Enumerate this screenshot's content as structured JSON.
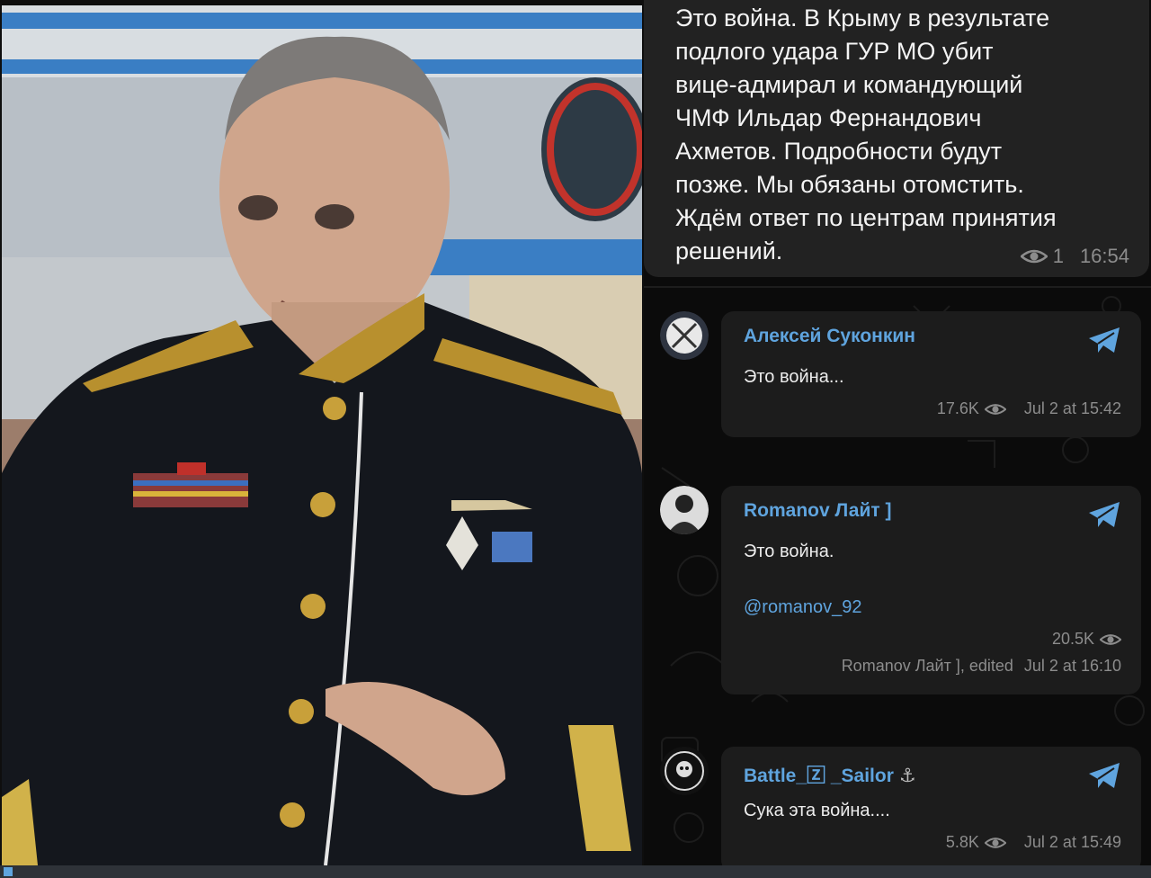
{
  "top_message": {
    "text": "Это война. В Крыму в результате\nподлого удара ГУР МО убит\nвице-адмирал и командующий\nЧМФ Ильдар Фернандович\nАхметов. Подробности будут\nпозже. Мы обязаны отомстить.\nЖдём ответ по центрам принятия\nрешений.",
    "views": "1",
    "time": "16:54"
  },
  "posts": [
    {
      "author": "Алексей Суконкин",
      "text": "Это война...",
      "views": "17.6K",
      "date": "Jul 2 at 15:42"
    },
    {
      "author": "Romanov Лайт ]",
      "text": "Это война.",
      "mention": "@romanov_92",
      "views": "20.5K",
      "signature": "Romanov Лайт ], edited",
      "date": "Jul 2 at 16:10"
    },
    {
      "author": "Battle_🅉 _Sailor",
      "author_suffix": "⚓",
      "text": "Сука эта война....",
      "views": "5.8K",
      "date": "Jul 2 at 15:49"
    }
  ],
  "icons": {
    "views": "eye-icon",
    "share": "telegram-share-icon"
  },
  "colors": {
    "accent": "#5fa4de",
    "chat_bg": "#0b0b0b",
    "bubble": "#1c1c1c"
  }
}
